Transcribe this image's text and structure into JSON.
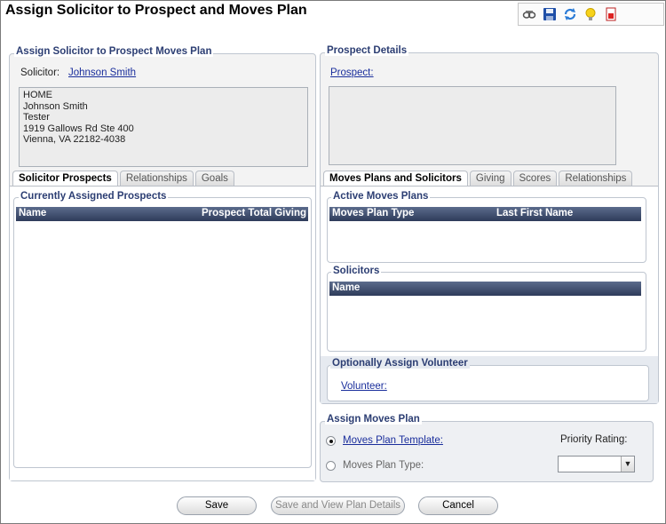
{
  "window": {
    "title": "Assign Solicitor to Prospect and Moves Plan"
  },
  "toolbar": {
    "icons": [
      "view-icon",
      "save-icon",
      "refresh-icon",
      "lightbulb-icon",
      "report-icon"
    ]
  },
  "left_panel": {
    "legend": "Assign Solicitor to Prospect Moves Plan",
    "solicitor_label": "Solicitor:",
    "solicitor_name": "Johnson Smith",
    "address_lines": [
      "HOME",
      "Johnson Smith",
      "Tester",
      "1919 Gallows Rd Ste 400",
      "Vienna, VA 22182-4038"
    ],
    "tabs": [
      "Solicitor Prospects",
      "Relationships",
      "Goals"
    ],
    "active_tab": "Solicitor Prospects",
    "assigned_legend": "Currently Assigned Prospects",
    "grid_columns": [
      "Name",
      "Prospect Total Giving"
    ]
  },
  "right_panel": {
    "legend": "Prospect Details",
    "prospect_link": "Prospect:",
    "tabs": [
      "Moves Plans and Solicitors",
      "Giving",
      "Scores",
      "Relationships"
    ],
    "active_tab": "Moves Plans and Solicitors",
    "active_plans_legend": "Active Moves Plans",
    "active_plans_columns": [
      "Moves Plan Type",
      "Last First Name"
    ],
    "solicitors_legend": "Solicitors",
    "solicitors_columns": [
      "Name"
    ],
    "volunteer_legend": "Optionally Assign Volunteer",
    "volunteer_link": "Volunteer:"
  },
  "assign_plan": {
    "legend": "Assign Moves Plan",
    "template_option": "Moves Plan Template:",
    "type_option": "Moves Plan Type:",
    "priority_label": "Priority Rating:",
    "priority_value": "",
    "selected": "template"
  },
  "buttons": {
    "save": "Save",
    "save_view": "Save and View Plan Details",
    "cancel": "Cancel"
  }
}
